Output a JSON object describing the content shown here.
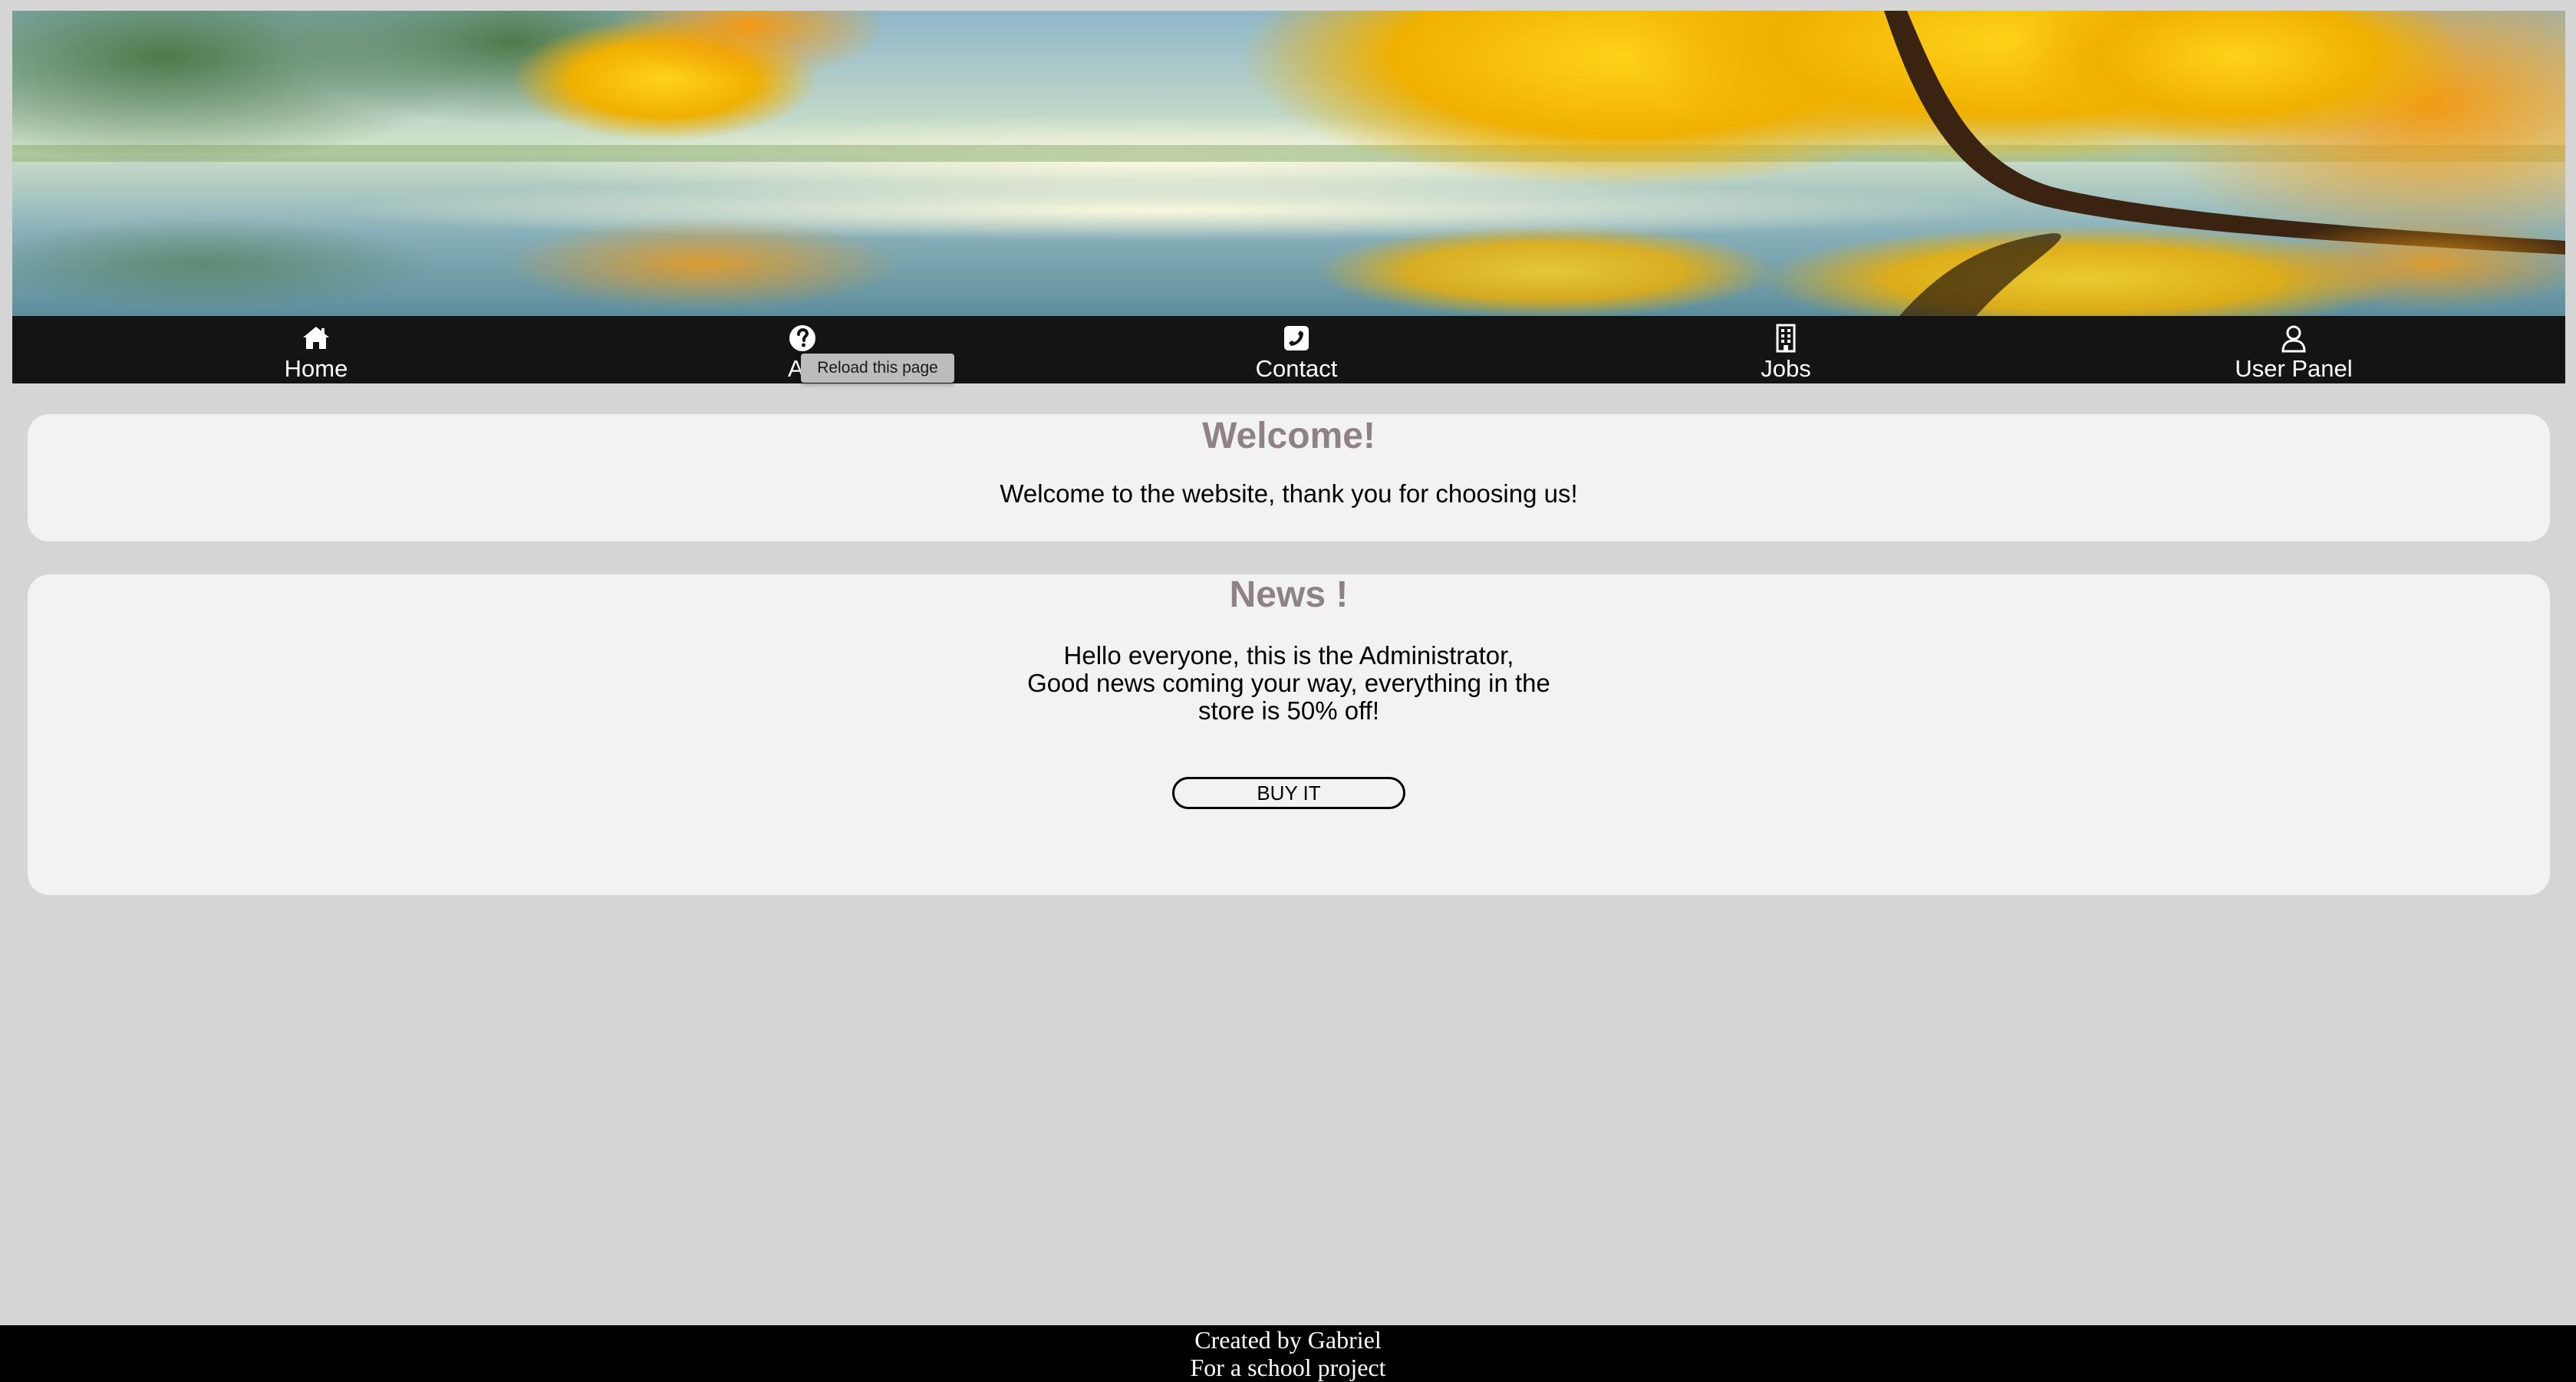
{
  "nav": {
    "items": [
      {
        "label": "Home",
        "icon": "home-icon"
      },
      {
        "label": "About",
        "icon": "question-circle-icon"
      },
      {
        "label": "Contact",
        "icon": "phone-icon"
      },
      {
        "label": "Jobs",
        "icon": "building-icon"
      },
      {
        "label": "User Panel",
        "icon": "user-icon"
      }
    ],
    "about_visible_label": "Ab",
    "tooltip": "Reload this page"
  },
  "welcome": {
    "title": "Welcome!",
    "text": "Welcome to the website, thank you for choosing us!"
  },
  "news": {
    "title": "News !",
    "lines": [
      "Hello everyone, this is the Administrator,",
      "Good news coming your way, everything in the",
      "store is 50% off!"
    ],
    "button_label": "BUY IT"
  },
  "footer": {
    "line1": "Created by Gabriel",
    "line2": "For a school project"
  },
  "colors": {
    "page_background": "#d5d5d5",
    "navbar": "#141414",
    "card": "#f2f2f2",
    "card_title": "#8e8287",
    "footer": "#000000"
  }
}
